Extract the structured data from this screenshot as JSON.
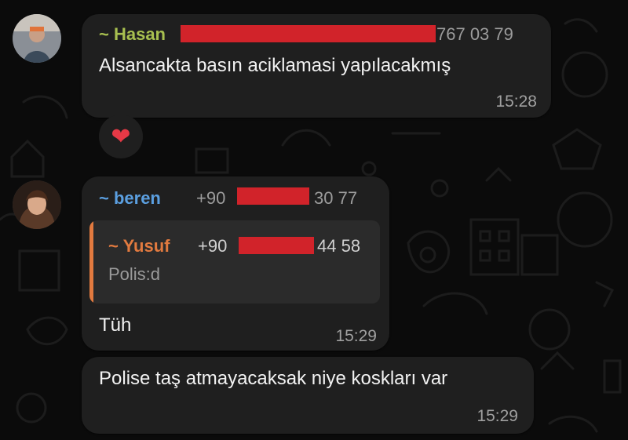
{
  "messages": [
    {
      "sender": "~ Hasan",
      "sender_color": "#a8c050",
      "phone_suffix": "767 03 79",
      "text": "Alsancakta basın aciklamasi yapılacakmış",
      "time": "15:28",
      "reaction": "❤"
    },
    {
      "sender": "~ beren",
      "sender_color": "#5b9fe0",
      "phone_prefix": "+90",
      "phone_suffix": "30 77",
      "quote": {
        "sender": "~ Yusuf",
        "sender_color": "#e27a3f",
        "phone_prefix": "+90",
        "phone_suffix": "44 58",
        "text": "Polis:d"
      },
      "text": "Tüh",
      "time": "15:29"
    },
    {
      "text": "Polise taş atmayacaksak niye koskları var",
      "time": "15:29"
    }
  ],
  "colors": {
    "background": "#0b0b0b",
    "bubble": "#1f1f1f",
    "redaction": "#d1232a"
  }
}
